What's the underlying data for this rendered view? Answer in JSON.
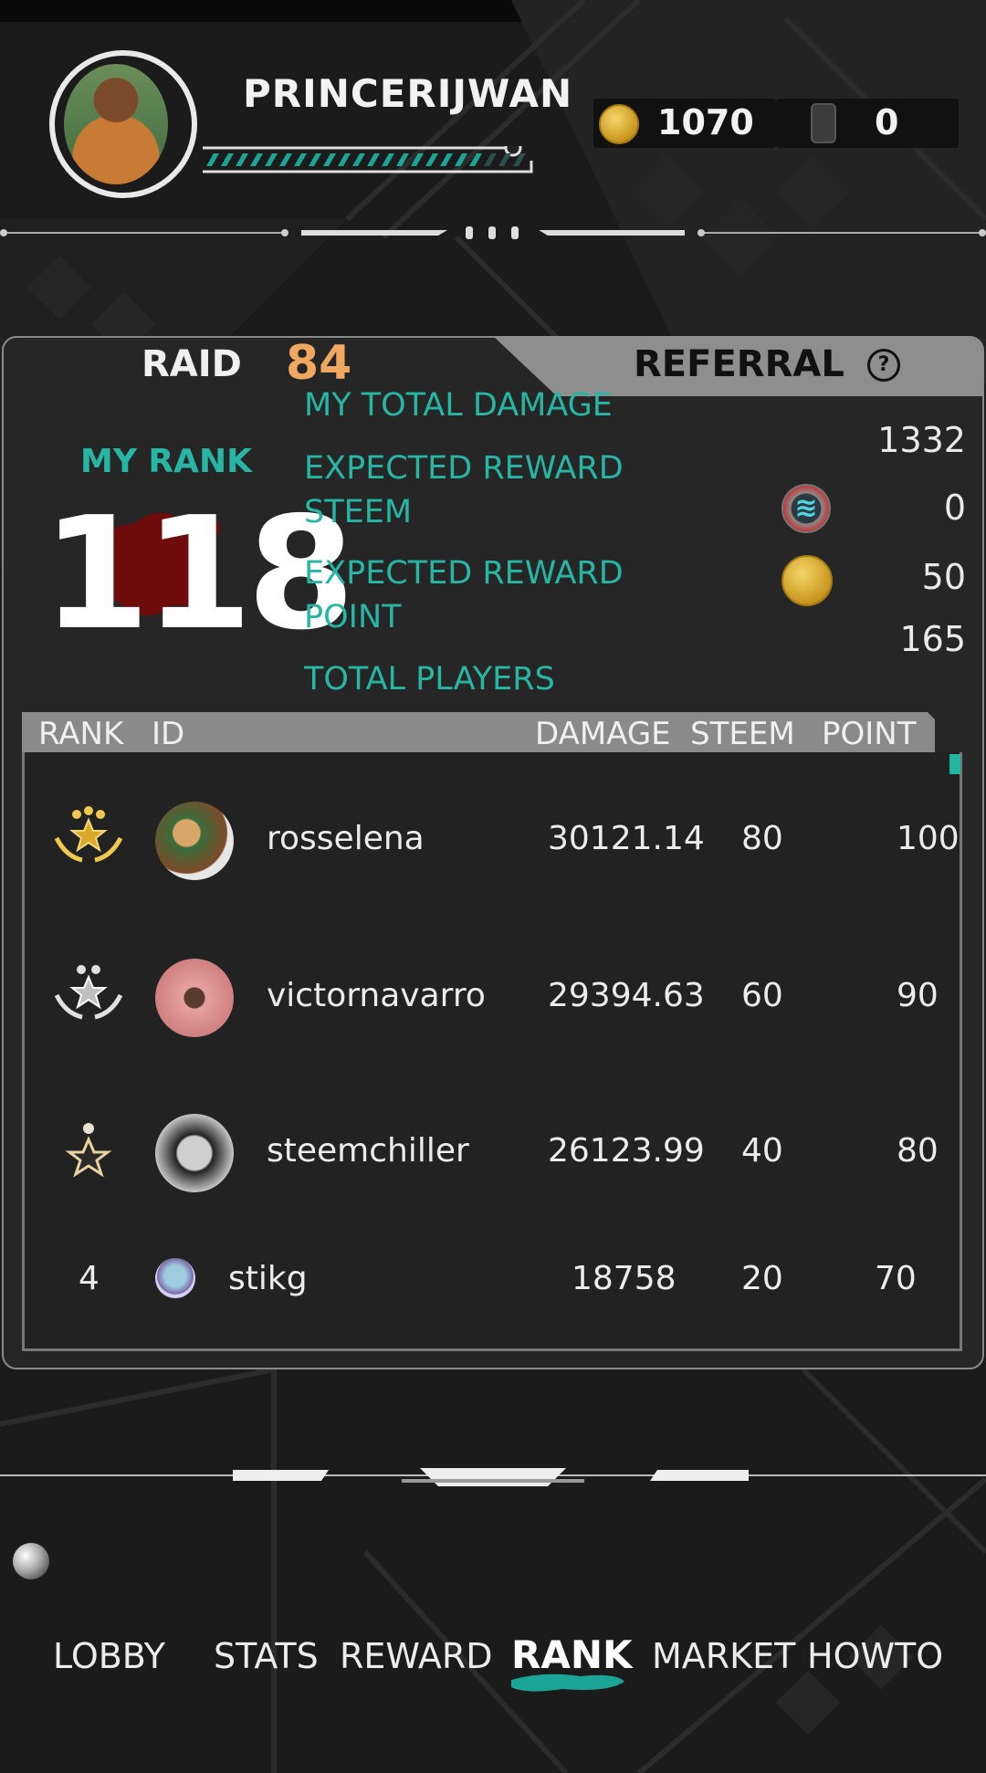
{
  "header": {
    "username": "PRINCERIJWAN",
    "xp_progress": 0.85,
    "coins": "1070",
    "gems": "0"
  },
  "tabs": {
    "raid_label": "RAID",
    "raid_number": "84",
    "referral_label": "REFERRAL",
    "help_glyph": "?"
  },
  "stats": {
    "my_rank_label": "MY RANK",
    "my_rank_value": "118",
    "total_damage_label": "MY TOTAL DAMAGE",
    "total_damage_value": "1332",
    "reward_steem_label_1": "EXPECTED REWARD",
    "reward_steem_label_2": "STEEM",
    "reward_steem_value": "0",
    "reward_point_label_1": "EXPECTED REWARD",
    "reward_point_label_2": "POINT",
    "reward_point_value": "50",
    "total_players_label": "TOTAL PLAYERS",
    "total_players_value": "165"
  },
  "table": {
    "headers": {
      "rank": "RANK",
      "id": "ID",
      "damage": "DAMAGE",
      "steem": "STEEM",
      "point": "POINT"
    },
    "rows": [
      {
        "rank": "1",
        "id": "rosselena",
        "damage": "30121.14",
        "steem": "80",
        "point": "100"
      },
      {
        "rank": "2",
        "id": "victornavarro",
        "damage": "29394.63",
        "steem": "60",
        "point": "90"
      },
      {
        "rank": "3",
        "id": "steemchiller",
        "damage": "26123.99",
        "steem": "40",
        "point": "80"
      },
      {
        "rank": "4",
        "id": "stikg",
        "damage": "18758",
        "steem": "20",
        "point": "70"
      }
    ]
  },
  "nav": {
    "lobby": "LOBBY",
    "stats": "STATS",
    "reward": "REWARD",
    "rank": "RANK",
    "market": "MARKET",
    "howto": "HOWTO",
    "active": "RANK"
  },
  "colors": {
    "accent_teal": "#27b6a4",
    "raid_number": "#f0a860",
    "blood_red": "#7a0c0c"
  }
}
